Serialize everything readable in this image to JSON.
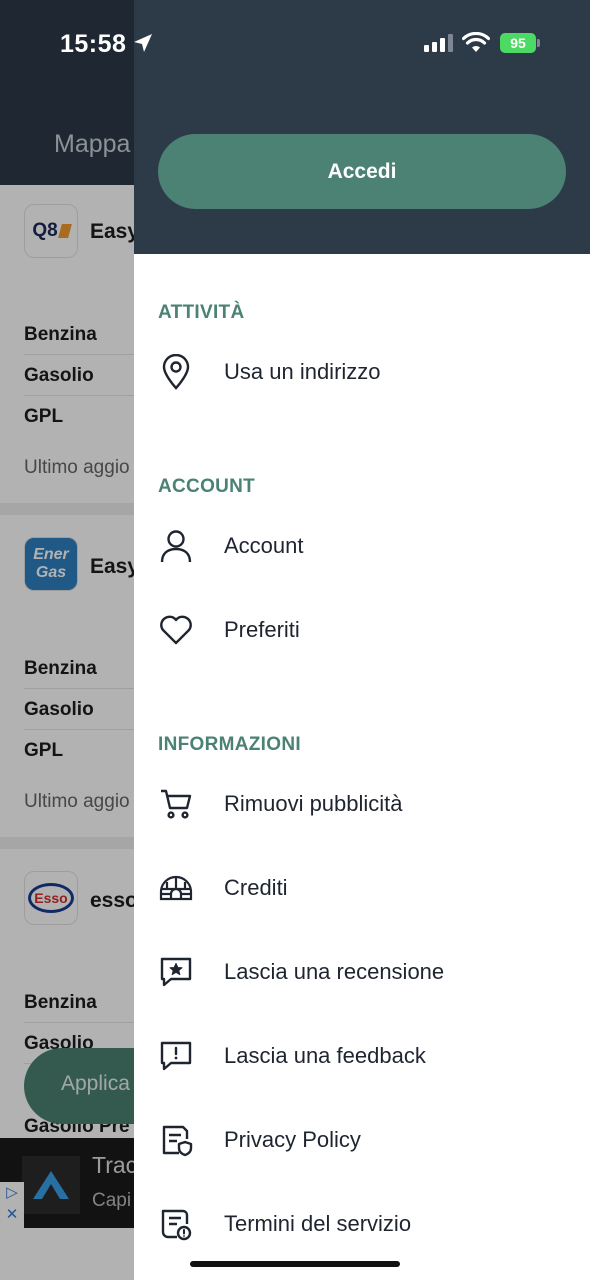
{
  "status_bar": {
    "time": "15:58",
    "battery": "95"
  },
  "background_screen": {
    "tab_label": "Mappa",
    "stations": [
      {
        "logo": "Q8",
        "name": "Easy",
        "fuels": [
          "Benzina",
          "Gasolio",
          "GPL"
        ],
        "updated": "Ultimo aggio"
      },
      {
        "logo_line1": "Ener",
        "logo_line2": "Gas",
        "name": "Easy",
        "fuels": [
          "Benzina",
          "Gasolio",
          "GPL"
        ],
        "updated": "Ultimo aggio"
      },
      {
        "logo": "Esso",
        "name": "esso",
        "fuels": [
          "Benzina",
          "Gasolio",
          "Gasolio Pre"
        ]
      }
    ],
    "apply_button": "Applica",
    "ad": {
      "title": "Trac",
      "subtitle": "Capi"
    }
  },
  "drawer": {
    "login_button": "Accedi",
    "sections": {
      "activity": {
        "title": "ATTIVITÀ",
        "items": [
          {
            "label": "Usa un indirizzo",
            "icon": "location-pin-icon"
          }
        ]
      },
      "account": {
        "title": "ACCOUNT",
        "items": [
          {
            "label": "Account",
            "icon": "person-icon"
          },
          {
            "label": "Preferiti",
            "icon": "heart-icon"
          }
        ]
      },
      "info": {
        "title": "INFORMAZIONI",
        "items": [
          {
            "label": "Rimuovi pubblicità",
            "icon": "cart-icon"
          },
          {
            "label": "Crediti",
            "icon": "igloo-icon"
          },
          {
            "label": "Lascia una recensione",
            "icon": "review-star-icon"
          },
          {
            "label": "Lascia una feedback",
            "icon": "feedback-exclamation-icon"
          },
          {
            "label": "Privacy Policy",
            "icon": "privacy-document-icon"
          },
          {
            "label": "Termini del servizio",
            "icon": "terms-document-icon"
          }
        ]
      }
    }
  },
  "colors": {
    "header_bg": "#2d3a48",
    "accent_green": "#4b8273",
    "battery_green": "#4cd964"
  }
}
